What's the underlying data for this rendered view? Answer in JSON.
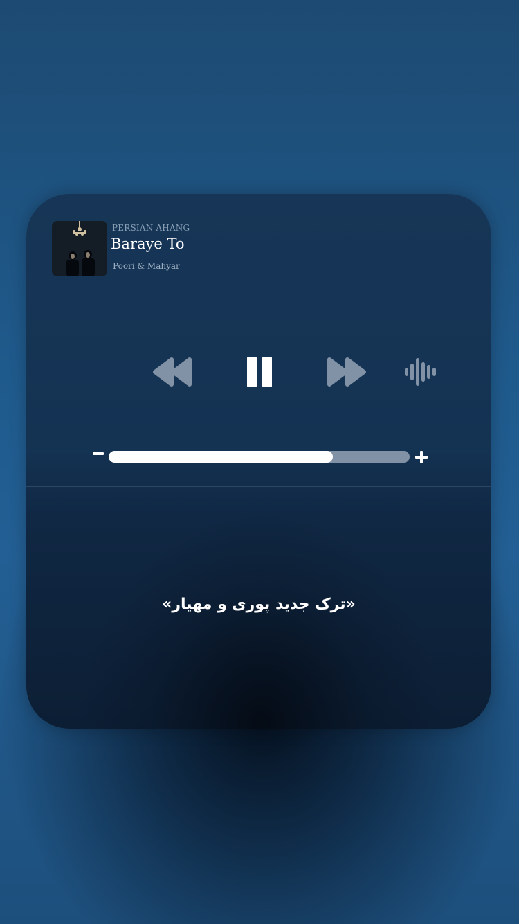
{
  "player": {
    "source": "PERSIAN AHANG",
    "title": "Baraye To",
    "artist": "Poori & Mahyar",
    "controls": {
      "rewind_icon": "rewind-icon",
      "pause_icon": "pause-icon",
      "forward_icon": "fast-forward-icon",
      "waveform_icon": "waveform-icon"
    },
    "volume": {
      "minus_icon": "minus-icon",
      "plus_icon": "plus-icon",
      "level": 0.745
    }
  },
  "caption": "«ترک جدید پوری و مهیار»",
  "colors": {
    "background": "#215a8c",
    "card": "#153453",
    "control_icon": "#8192a6",
    "text_primary": "#ffffff"
  }
}
